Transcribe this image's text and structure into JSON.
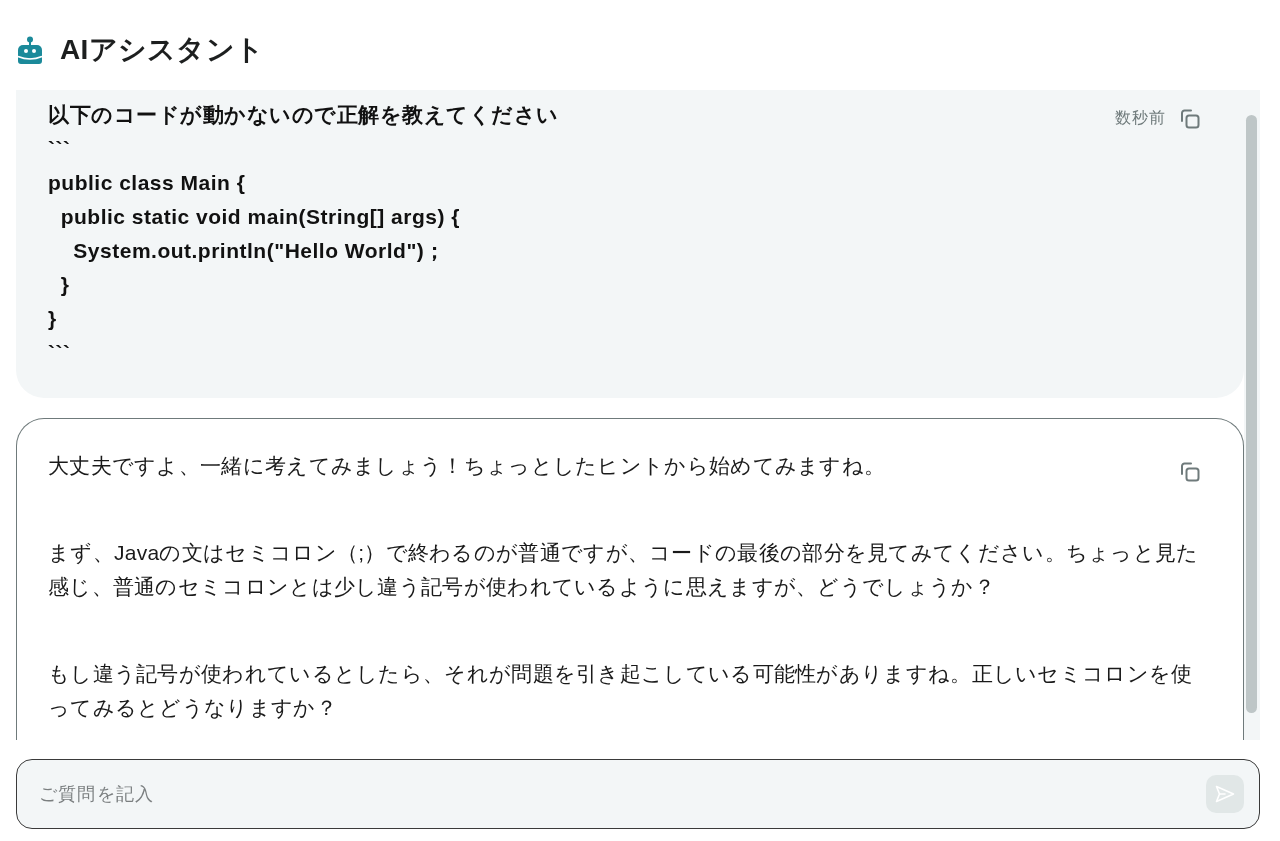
{
  "header": {
    "title": "AIアシスタント"
  },
  "messages": [
    {
      "kind": "user",
      "time": "数秒前",
      "text": "以下のコードが動かないので正解を教えてください\n```\npublic class Main {\n  public static void main(String[] args) {\n    System.out.println(\"Hello World\")；\n  }\n}\n```"
    },
    {
      "kind": "assistant",
      "paragraphs": [
        "大丈夫ですよ、一緒に考えてみましょう！ちょっとしたヒントから始めてみますね。",
        "まず、Javaの文はセミコロン（;）で終わるのが普通ですが、コードの最後の部分を見てみてください。ちょっと見た感じ、普通のセミコロンとは少し違う記号が使われているように思えますが、どうでしょうか？",
        "もし違う記号が使われているとしたら、それが問題を引き起こしている可能性がありますね。正しいセミコロンを使ってみるとどうなりますか？"
      ]
    }
  ],
  "composer": {
    "placeholder": "ご質問を記入",
    "send_button": {
      "disabled": true
    }
  }
}
